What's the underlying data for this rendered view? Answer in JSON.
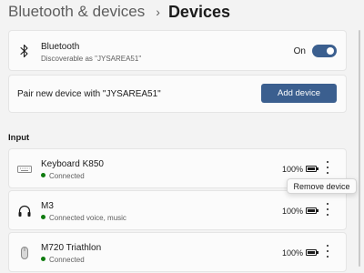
{
  "header": {
    "parent": "Bluetooth & devices",
    "separator": "›",
    "current": "Devices"
  },
  "bluetooth": {
    "label": "Bluetooth",
    "status": "Discoverable as \"JYSAREA51\"",
    "toggle_label": "On",
    "toggle_on": true,
    "icon": "bluetooth-icon"
  },
  "pair": {
    "label": "Pair new device with \"JYSAREA51\"",
    "button": "Add device"
  },
  "input_section": {
    "label": "Input",
    "devices": [
      {
        "name": "Keyboard K850",
        "status": "Connected",
        "battery": "100%",
        "icon": "keyboard-icon"
      },
      {
        "name": "M3",
        "status": "Connected voice, music",
        "battery": "100%",
        "icon": "headphones-icon"
      },
      {
        "name": "M720 Triathlon",
        "status": "Connected",
        "battery": "100%",
        "icon": "mouse-icon"
      }
    ]
  },
  "tooltip": "Remove device",
  "colors": {
    "accent": "#3b5f8f",
    "connected": "#0f7b0f",
    "background": "#f3f3f3",
    "card": "#fbfbfb"
  }
}
